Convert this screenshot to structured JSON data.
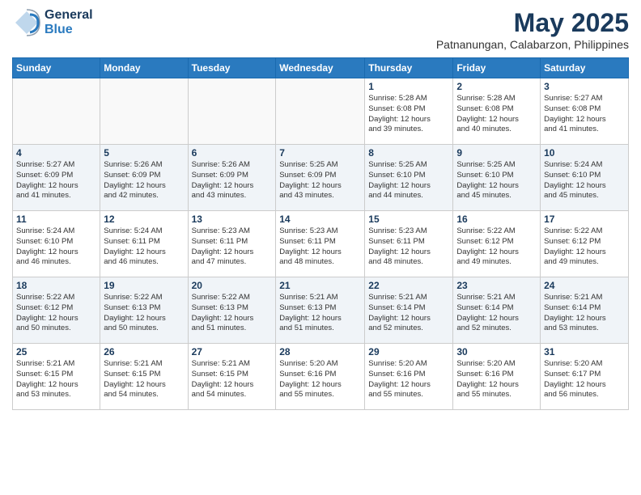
{
  "header": {
    "logo_general": "General",
    "logo_blue": "Blue",
    "month_title": "May 2025",
    "location": "Patnanungan, Calabarzon, Philippines"
  },
  "weekdays": [
    "Sunday",
    "Monday",
    "Tuesday",
    "Wednesday",
    "Thursday",
    "Friday",
    "Saturday"
  ],
  "weeks": [
    [
      {
        "day": "",
        "info": ""
      },
      {
        "day": "",
        "info": ""
      },
      {
        "day": "",
        "info": ""
      },
      {
        "day": "",
        "info": ""
      },
      {
        "day": "1",
        "info": "Sunrise: 5:28 AM\nSunset: 6:08 PM\nDaylight: 12 hours\nand 39 minutes."
      },
      {
        "day": "2",
        "info": "Sunrise: 5:28 AM\nSunset: 6:08 PM\nDaylight: 12 hours\nand 40 minutes."
      },
      {
        "day": "3",
        "info": "Sunrise: 5:27 AM\nSunset: 6:08 PM\nDaylight: 12 hours\nand 41 minutes."
      }
    ],
    [
      {
        "day": "4",
        "info": "Sunrise: 5:27 AM\nSunset: 6:09 PM\nDaylight: 12 hours\nand 41 minutes."
      },
      {
        "day": "5",
        "info": "Sunrise: 5:26 AM\nSunset: 6:09 PM\nDaylight: 12 hours\nand 42 minutes."
      },
      {
        "day": "6",
        "info": "Sunrise: 5:26 AM\nSunset: 6:09 PM\nDaylight: 12 hours\nand 43 minutes."
      },
      {
        "day": "7",
        "info": "Sunrise: 5:25 AM\nSunset: 6:09 PM\nDaylight: 12 hours\nand 43 minutes."
      },
      {
        "day": "8",
        "info": "Sunrise: 5:25 AM\nSunset: 6:10 PM\nDaylight: 12 hours\nand 44 minutes."
      },
      {
        "day": "9",
        "info": "Sunrise: 5:25 AM\nSunset: 6:10 PM\nDaylight: 12 hours\nand 45 minutes."
      },
      {
        "day": "10",
        "info": "Sunrise: 5:24 AM\nSunset: 6:10 PM\nDaylight: 12 hours\nand 45 minutes."
      }
    ],
    [
      {
        "day": "11",
        "info": "Sunrise: 5:24 AM\nSunset: 6:10 PM\nDaylight: 12 hours\nand 46 minutes."
      },
      {
        "day": "12",
        "info": "Sunrise: 5:24 AM\nSunset: 6:11 PM\nDaylight: 12 hours\nand 46 minutes."
      },
      {
        "day": "13",
        "info": "Sunrise: 5:23 AM\nSunset: 6:11 PM\nDaylight: 12 hours\nand 47 minutes."
      },
      {
        "day": "14",
        "info": "Sunrise: 5:23 AM\nSunset: 6:11 PM\nDaylight: 12 hours\nand 48 minutes."
      },
      {
        "day": "15",
        "info": "Sunrise: 5:23 AM\nSunset: 6:11 PM\nDaylight: 12 hours\nand 48 minutes."
      },
      {
        "day": "16",
        "info": "Sunrise: 5:22 AM\nSunset: 6:12 PM\nDaylight: 12 hours\nand 49 minutes."
      },
      {
        "day": "17",
        "info": "Sunrise: 5:22 AM\nSunset: 6:12 PM\nDaylight: 12 hours\nand 49 minutes."
      }
    ],
    [
      {
        "day": "18",
        "info": "Sunrise: 5:22 AM\nSunset: 6:12 PM\nDaylight: 12 hours\nand 50 minutes."
      },
      {
        "day": "19",
        "info": "Sunrise: 5:22 AM\nSunset: 6:13 PM\nDaylight: 12 hours\nand 50 minutes."
      },
      {
        "day": "20",
        "info": "Sunrise: 5:22 AM\nSunset: 6:13 PM\nDaylight: 12 hours\nand 51 minutes."
      },
      {
        "day": "21",
        "info": "Sunrise: 5:21 AM\nSunset: 6:13 PM\nDaylight: 12 hours\nand 51 minutes."
      },
      {
        "day": "22",
        "info": "Sunrise: 5:21 AM\nSunset: 6:14 PM\nDaylight: 12 hours\nand 52 minutes."
      },
      {
        "day": "23",
        "info": "Sunrise: 5:21 AM\nSunset: 6:14 PM\nDaylight: 12 hours\nand 52 minutes."
      },
      {
        "day": "24",
        "info": "Sunrise: 5:21 AM\nSunset: 6:14 PM\nDaylight: 12 hours\nand 53 minutes."
      }
    ],
    [
      {
        "day": "25",
        "info": "Sunrise: 5:21 AM\nSunset: 6:15 PM\nDaylight: 12 hours\nand 53 minutes."
      },
      {
        "day": "26",
        "info": "Sunrise: 5:21 AM\nSunset: 6:15 PM\nDaylight: 12 hours\nand 54 minutes."
      },
      {
        "day": "27",
        "info": "Sunrise: 5:21 AM\nSunset: 6:15 PM\nDaylight: 12 hours\nand 54 minutes."
      },
      {
        "day": "28",
        "info": "Sunrise: 5:20 AM\nSunset: 6:16 PM\nDaylight: 12 hours\nand 55 minutes."
      },
      {
        "day": "29",
        "info": "Sunrise: 5:20 AM\nSunset: 6:16 PM\nDaylight: 12 hours\nand 55 minutes."
      },
      {
        "day": "30",
        "info": "Sunrise: 5:20 AM\nSunset: 6:16 PM\nDaylight: 12 hours\nand 55 minutes."
      },
      {
        "day": "31",
        "info": "Sunrise: 5:20 AM\nSunset: 6:17 PM\nDaylight: 12 hours\nand 56 minutes."
      }
    ]
  ]
}
